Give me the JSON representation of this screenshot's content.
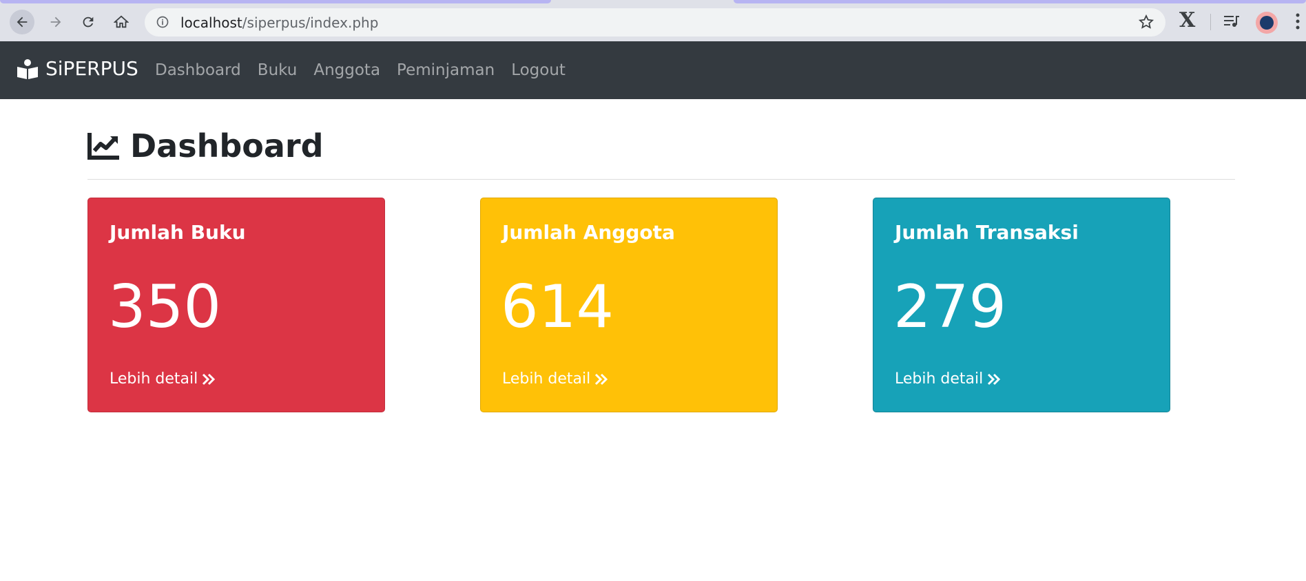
{
  "browser": {
    "url_host": "localhost",
    "url_path": "/siperpus/index.php",
    "extension_label": "X"
  },
  "navbar": {
    "brand": "SiPERPUS",
    "links": [
      {
        "label": "Dashboard"
      },
      {
        "label": "Buku"
      },
      {
        "label": "Anggota"
      },
      {
        "label": "Peminjaman"
      },
      {
        "label": "Logout"
      }
    ]
  },
  "page": {
    "title": "Dashboard"
  },
  "cards": [
    {
      "title": "Jumlah Buku",
      "value": "350",
      "detail": "Lebih detail",
      "color": "#dc3545"
    },
    {
      "title": "Jumlah Anggota",
      "value": "614",
      "detail": "Lebih detail",
      "color": "#ffc107"
    },
    {
      "title": "Jumlah Transaksi",
      "value": "279",
      "detail": "Lebih detail",
      "color": "#17a2b8"
    }
  ],
  "icons": {
    "back": "arrow-left-icon",
    "forward": "arrow-right-icon",
    "reload": "reload-icon",
    "home": "home-icon",
    "info": "info-icon",
    "bookmark": "star-icon",
    "media": "media-queue-icon",
    "menu": "kebab-menu-icon",
    "brand": "reader-book-icon",
    "title": "chart-line-icon",
    "detail": "double-chevron-right-icon"
  }
}
